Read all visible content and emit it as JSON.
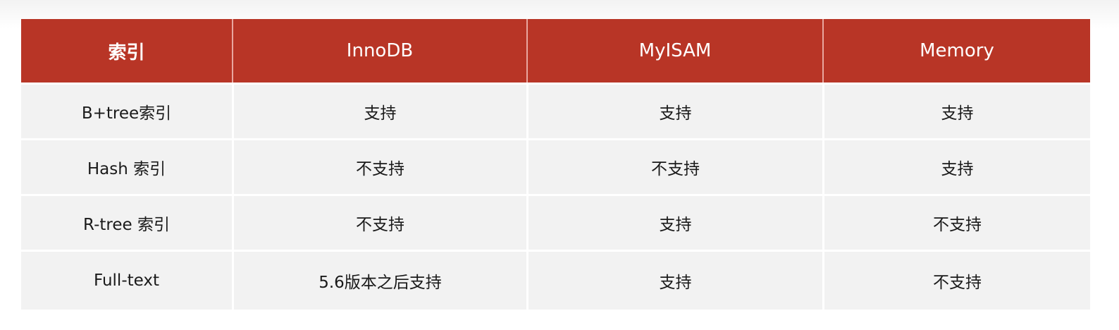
{
  "table": {
    "headers": [
      "索引",
      "InnoDB",
      "MyISAM",
      "Memory"
    ],
    "rows": [
      [
        "B+tree索引",
        "支持",
        "支持",
        "支持"
      ],
      [
        "Hash 索引",
        "不支持",
        "不支持",
        "支持"
      ],
      [
        "R-tree 索引",
        "不支持",
        "支持",
        "不支持"
      ],
      [
        "Full-text",
        "5.6版本之后支持",
        "支持",
        "不支持"
      ]
    ]
  },
  "colors": {
    "header_background": "#b83526",
    "header_text": "#ffffff",
    "row_background": "#f2f2f2",
    "row_text": "#1a1a1a"
  }
}
